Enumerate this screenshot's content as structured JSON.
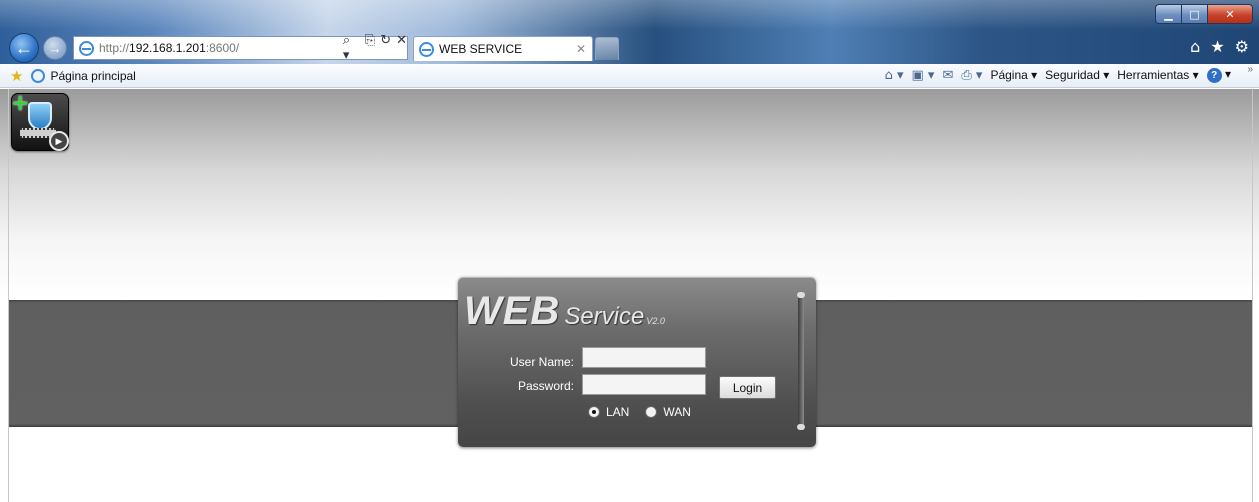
{
  "browser": {
    "address": {
      "url_prefix": "http://",
      "url_host": "192.168.1.201",
      "url_suffix": ":8600/",
      "tools": [
        "⌕ ▾",
        "⎘",
        "↻",
        "✕"
      ]
    },
    "tab": {
      "title": "WEB SERVICE",
      "close": "✕"
    },
    "window_buttons": {
      "minimize": "▁",
      "maximize": "□",
      "close": "✕"
    },
    "right_icons": [
      "home-icon",
      "favorites-star-icon",
      "settings-gear-icon"
    ],
    "favorites_bar": {
      "link": "Página principal"
    },
    "command_bar": {
      "pagina": "Página ▾",
      "seguridad": "Seguridad ▾",
      "herramientas": "Herramientas ▾",
      "help": "?",
      "chevron": "»"
    }
  },
  "page": {
    "login": {
      "logo_web": "WEB",
      "logo_service": "Service",
      "logo_version": "V2.0",
      "username_label": "User Name:",
      "username_value": "",
      "password_label": "Password:",
      "password_value": "",
      "login_button": "Login",
      "lan_label": "LAN",
      "wan_label": "WAN",
      "selected_network": "LAN"
    }
  }
}
